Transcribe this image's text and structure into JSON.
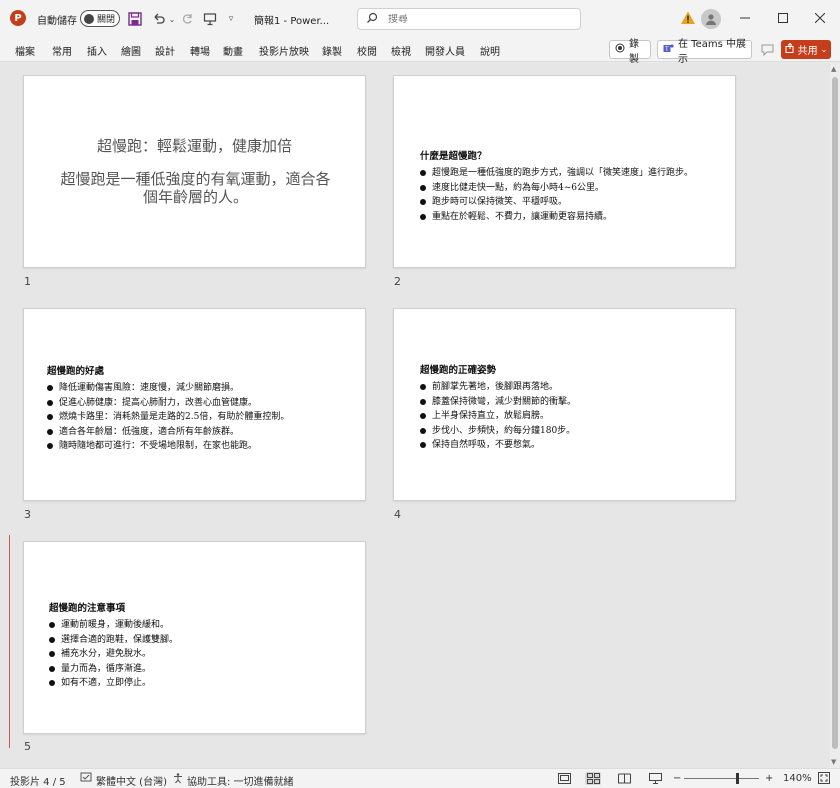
{
  "titlebar": {
    "app_icon_letter": "P",
    "autosave_label": "自動儲存",
    "autosave_state": "關閉",
    "doc_title": "簡報1 - Power...",
    "search_placeholder": "搜尋",
    "icons": [
      "save-icon",
      "undo-icon",
      "redo-icon",
      "present-icon",
      "customize-icon",
      "warning-icon",
      "avatar-icon",
      "minimize-icon",
      "maximize-icon",
      "close-icon"
    ]
  },
  "menu": {
    "items": [
      "檔案",
      "常用",
      "插入",
      "繪圖",
      "設計",
      "轉場",
      "動畫",
      "投影片放映",
      "錄製",
      "校閱",
      "檢視",
      "開發人員",
      "說明"
    ],
    "record_label": "錄製",
    "teams_label": "在 Teams 中展示",
    "share_label": "共用"
  },
  "slides": [
    {
      "number": "1",
      "title": "超慢跑：輕鬆運動，健康加倍",
      "subtitle": "超慢跑是一種低強度的有氧運動，適合各個年齡層的人。"
    },
    {
      "number": "2",
      "heading": "什麼是超慢跑？",
      "bullets": [
        "超慢跑是一種低強度的跑步方式，強調以「微笑速度」進行跑步。",
        "速度比健走快一點，約為每小時4~6公里。",
        "跑步時可以保持微笑、平穩呼吸。",
        "重點在於輕鬆、不費力，讓運動更容易持續。"
      ]
    },
    {
      "number": "3",
      "heading": "超慢跑的好處",
      "bullets": [
        "降低運動傷害風險：速度慢，減少關節磨損。",
        "促進心肺健康：提高心肺耐力，改善心血管健康。",
        "燃燒卡路里：消耗熱量是走路的2.5倍，有助於體重控制。",
        "適合各年齡層：低強度，適合所有年齡族群。",
        "隨時隨地都可進行：不受場地限制，在家也能跑。"
      ]
    },
    {
      "number": "4",
      "heading": "超慢跑的正確姿勢",
      "bullets": [
        "前腳掌先著地，後腳跟再落地。",
        "膝蓋保持微彎，減少對關節的衝擊。",
        "上半身保持直立，放鬆肩膀。",
        "步伐小、步頻快，約每分鐘180步。",
        "保持自然呼吸，不要憋氣。"
      ]
    },
    {
      "number": "5",
      "heading": "超慢跑的注意事項",
      "bullets": [
        "運動前暖身，運動後緩和。",
        "選擇合適的跑鞋，保護雙腳。",
        "補充水分，避免脫水。",
        "量力而為，循序漸進。",
        "如有不適，立即停止。"
      ]
    }
  ],
  "status": {
    "slide_info": "投影片 4 / 5",
    "language": "繁體中文 (台灣)",
    "accessibility": "協助工具: 一切進備就緒",
    "zoom_minus": "−",
    "zoom_plus": "+",
    "zoom_level": "140%"
  },
  "colors": {
    "brand": "#c43e1c",
    "marker": "#d9534f"
  }
}
